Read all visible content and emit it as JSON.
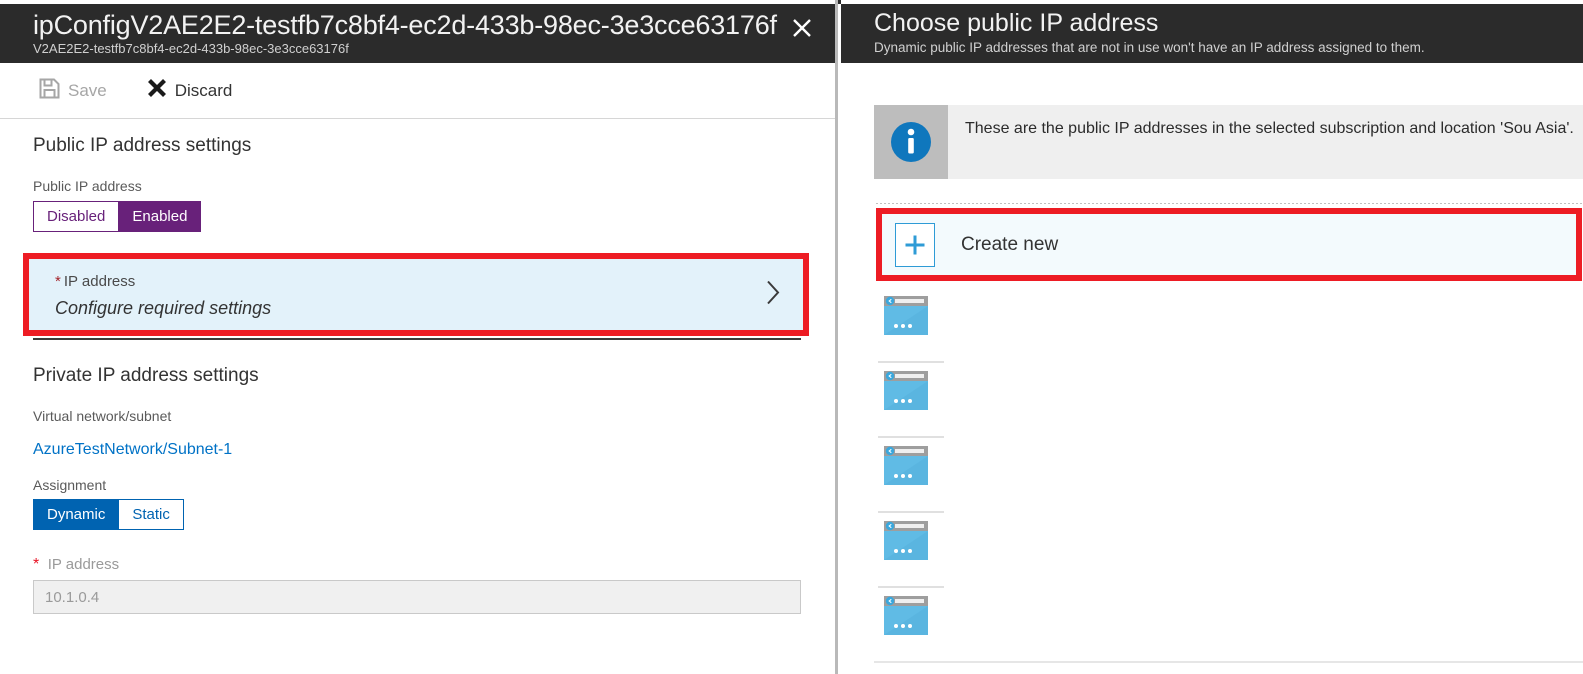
{
  "left_blade": {
    "title": "ipConfigV2AE2E2-testfb7c8bf4-ec2d-433b-98ec-3e3cce63176f",
    "subtitle": "V2AE2E2-testfb7c8bf4-ec2d-433b-98ec-3e3cce63176f",
    "close_icon": "close-icon",
    "toolbar": {
      "save_label": "Save",
      "save_icon": "save-icon",
      "save_enabled": "false",
      "discard_label": "Discard",
      "discard_icon": "discard-x-icon",
      "discard_enabled": "true"
    },
    "public_section": {
      "heading": "Public IP address settings",
      "field_label": "Public IP address",
      "toggle": {
        "off_label": "Disabled",
        "on_label": "Enabled",
        "selected": "Enabled",
        "accent_color": "#68217A"
      },
      "picker": {
        "required_marker": "*",
        "label": "IP address",
        "value": "Configure required settings",
        "chevron_icon": "chevron-right-icon",
        "highlight_color": "#ED1C24",
        "background_color": "#E3F2FA"
      }
    },
    "private_section": {
      "heading": "Private IP address settings",
      "vnet_label": "Virtual network/subnet",
      "vnet_value": "AzureTestNetwork/Subnet-1",
      "vnet_link_color": "#0072C6",
      "assignment_label": "Assignment",
      "assignment_toggle": {
        "on_label": "Dynamic",
        "off_label": "Static",
        "selected": "Dynamic",
        "accent_color": "#0063B1"
      },
      "ip_required_marker": "*",
      "ip_label": "IP address",
      "ip_value": "10.1.0.4",
      "ip_disabled": "true"
    }
  },
  "right_blade": {
    "title": "Choose public IP address",
    "subtitle": "Dynamic public IP addresses that are not in use won't have an IP address assigned to them.",
    "info_banner": {
      "icon": "info-icon",
      "text": "These are the public IP addresses in the selected subscription and location 'Sou Asia'."
    },
    "create_new": {
      "label": "Create new",
      "icon": "plus-icon",
      "highlight_color": "#ED1C24"
    },
    "list": {
      "items": [
        {
          "icon": "public-ip-address-icon",
          "label": ""
        },
        {
          "icon": "public-ip-address-icon",
          "label": ""
        },
        {
          "icon": "public-ip-address-icon",
          "label": ""
        },
        {
          "icon": "public-ip-address-icon",
          "label": ""
        },
        {
          "icon": "public-ip-address-icon",
          "label": ""
        }
      ]
    }
  }
}
